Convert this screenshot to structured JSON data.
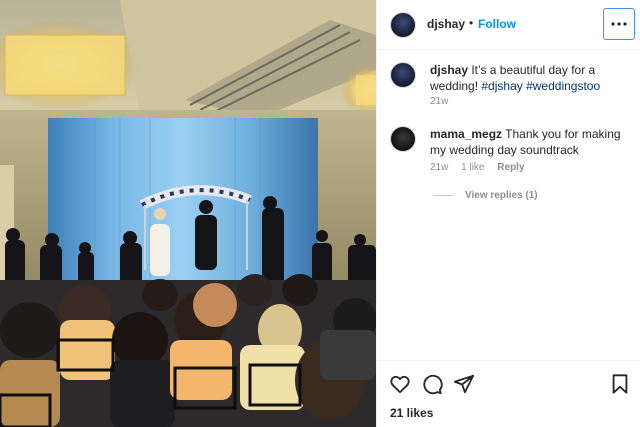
{
  "post": {
    "author": "djshay",
    "separator": "•",
    "follow_label": "Follow",
    "more_icon": "more-horizontal-icon",
    "caption": {
      "user": "djshay",
      "text": " It’s a beautiful day for a wedding! ",
      "tag1": "#djshay",
      "tag2": "#weddingstoo",
      "time": "21w"
    },
    "comments": [
      {
        "user": "mama_megz",
        "text": " Thank you for making my wedding day soundtrack",
        "time": "21w",
        "likes": "1 like",
        "reply_label": "Reply",
        "view_replies": "View replies (1)"
      }
    ],
    "likes": "21 likes"
  },
  "icons": {
    "like": "heart-icon",
    "comment": "comment-icon",
    "share": "share-icon",
    "save": "bookmark-icon"
  },
  "colors": {
    "accent": "#0095f6",
    "text": "#262626",
    "muted": "#8e8e8e",
    "hashtag": "#00376b"
  }
}
